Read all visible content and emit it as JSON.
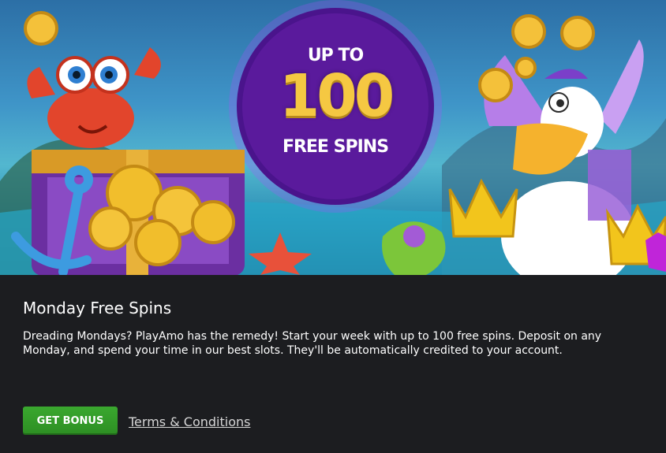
{
  "promo": {
    "badge_line1": "UP TO",
    "badge_number": "100",
    "badge_line2": "FREE SPINS",
    "title": "Monday Free Spins",
    "description": "Dreading Mondays? PlayAmo has the remedy! Start your week with up to 100 free spins. Deposit on any Monday, and spend your time in our best slots. They'll be automatically credited to your account.",
    "cta_label": "GET BONUS",
    "terms_label": "Terms & Conditions"
  },
  "colors": {
    "panel_background": "#1c1d20",
    "cta_green": "#34a029",
    "badge_purple": "#5a1a9c",
    "coin_gold": "#f5c842"
  },
  "icons": [
    "crab-illustration",
    "treasure-chest-illustration",
    "gold-coin-icon",
    "anchor-illustration",
    "starfish-illustration",
    "shell-illustration",
    "pelican-illustration",
    "crown-illustration"
  ]
}
